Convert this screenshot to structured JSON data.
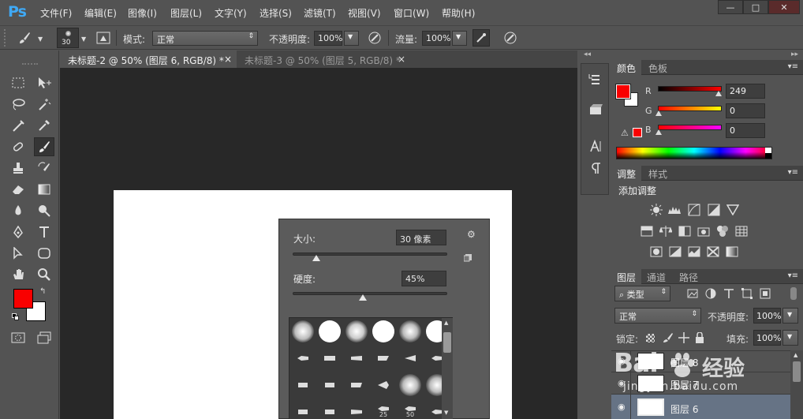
{
  "app": {
    "logo": "Ps"
  },
  "menu": [
    "文件(F)",
    "编辑(E)",
    "图像(I)",
    "图层(L)",
    "文字(Y)",
    "选择(S)",
    "滤镜(T)",
    "视图(V)",
    "窗口(W)",
    "帮助(H)"
  ],
  "window_controls": {
    "minimize": "—",
    "maximize": "□",
    "close": "✕"
  },
  "options": {
    "brush_size": "30",
    "mode_label": "模式:",
    "mode_value": "正常",
    "opacity_label": "不透明度:",
    "opacity_value": "100%",
    "flow_label": "流量:",
    "flow_value": "100%"
  },
  "tabs": [
    {
      "label": "未标题-2 @ 50% (图层 6, RGB/8) *",
      "close": "×"
    },
    {
      "label": "未标题-3 @ 50% (图层 5, RGB/8) *",
      "close": "×"
    }
  ],
  "brush_popup": {
    "size_label": "大小:",
    "size_value": "30 像素",
    "size_fraction": 0.15,
    "hardness_label": "硬度:",
    "hardness_value": "45%",
    "hardness_fraction": 0.45,
    "brush_nums": [
      "25",
      "50"
    ]
  },
  "color_panel": {
    "tabs": [
      "颜色",
      "色板"
    ],
    "r_label": "R",
    "r_value": "249",
    "g_label": "G",
    "g_value": "0",
    "b_label": "B",
    "b_value": "0",
    "foreground": "#f90000",
    "background": "#ffffff"
  },
  "adjust_panel": {
    "tabs": [
      "调整",
      "样式"
    ],
    "title": "添加调整"
  },
  "layers_panel": {
    "tabs": [
      "图层",
      "通道",
      "路径"
    ],
    "filter_value": "类型",
    "blend_value": "正常",
    "opacity_label": "不透明度:",
    "opacity_value": "100%",
    "lock_label": "锁定:",
    "fill_label": "填充:",
    "fill_value": "100%",
    "layers": [
      "图层 8",
      "图层 7",
      "图层 6"
    ]
  },
  "watermark": {
    "brand": "Bai",
    "brand2": "经验",
    "url": "jingyan.baidu.com"
  }
}
